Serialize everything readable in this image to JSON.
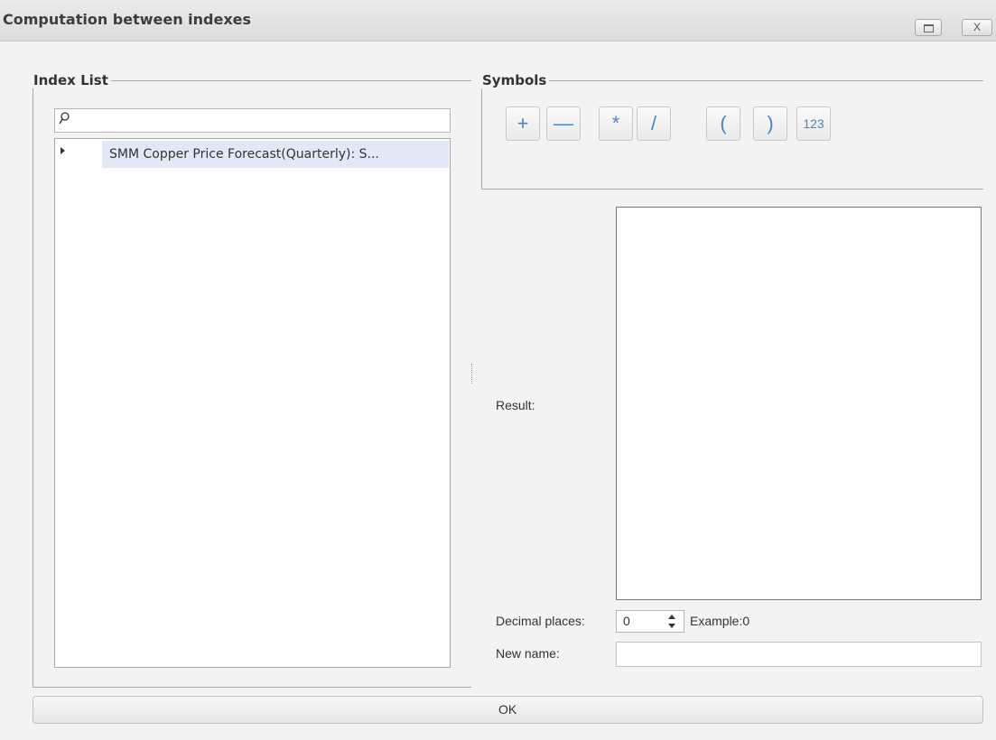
{
  "window": {
    "title": "Computation between indexes",
    "restore_icon": "restore-icon",
    "close_label": "X"
  },
  "index_list": {
    "legend": "Index List",
    "search": {
      "value": "",
      "icon": "search-icon"
    },
    "items": [
      {
        "label": "SMM Copper Price Forecast(Quarterly): S...",
        "expander_icon": "expand-arrow-icon",
        "selected": true
      }
    ]
  },
  "symbols": {
    "legend": "Symbols",
    "buttons": [
      {
        "name": "plus",
        "label": "+"
      },
      {
        "name": "minus",
        "label": "—"
      },
      {
        "name": "multiply",
        "label": "*"
      },
      {
        "name": "divide",
        "label": "/"
      },
      {
        "name": "open-paren",
        "label": "("
      },
      {
        "name": "close-paren",
        "label": ")"
      },
      {
        "name": "number",
        "label": "123"
      }
    ]
  },
  "form": {
    "result_label": "Result:",
    "result_value": "",
    "decimal_label": "Decimal places:",
    "decimal_value": "0",
    "example_label": "Example:0",
    "new_name_label": "New name:",
    "new_name_value": ""
  },
  "ok_button": {
    "label": "OK"
  },
  "colors": {
    "symbol_accent": "#4a86c6",
    "selection": "#e2e8f6"
  }
}
